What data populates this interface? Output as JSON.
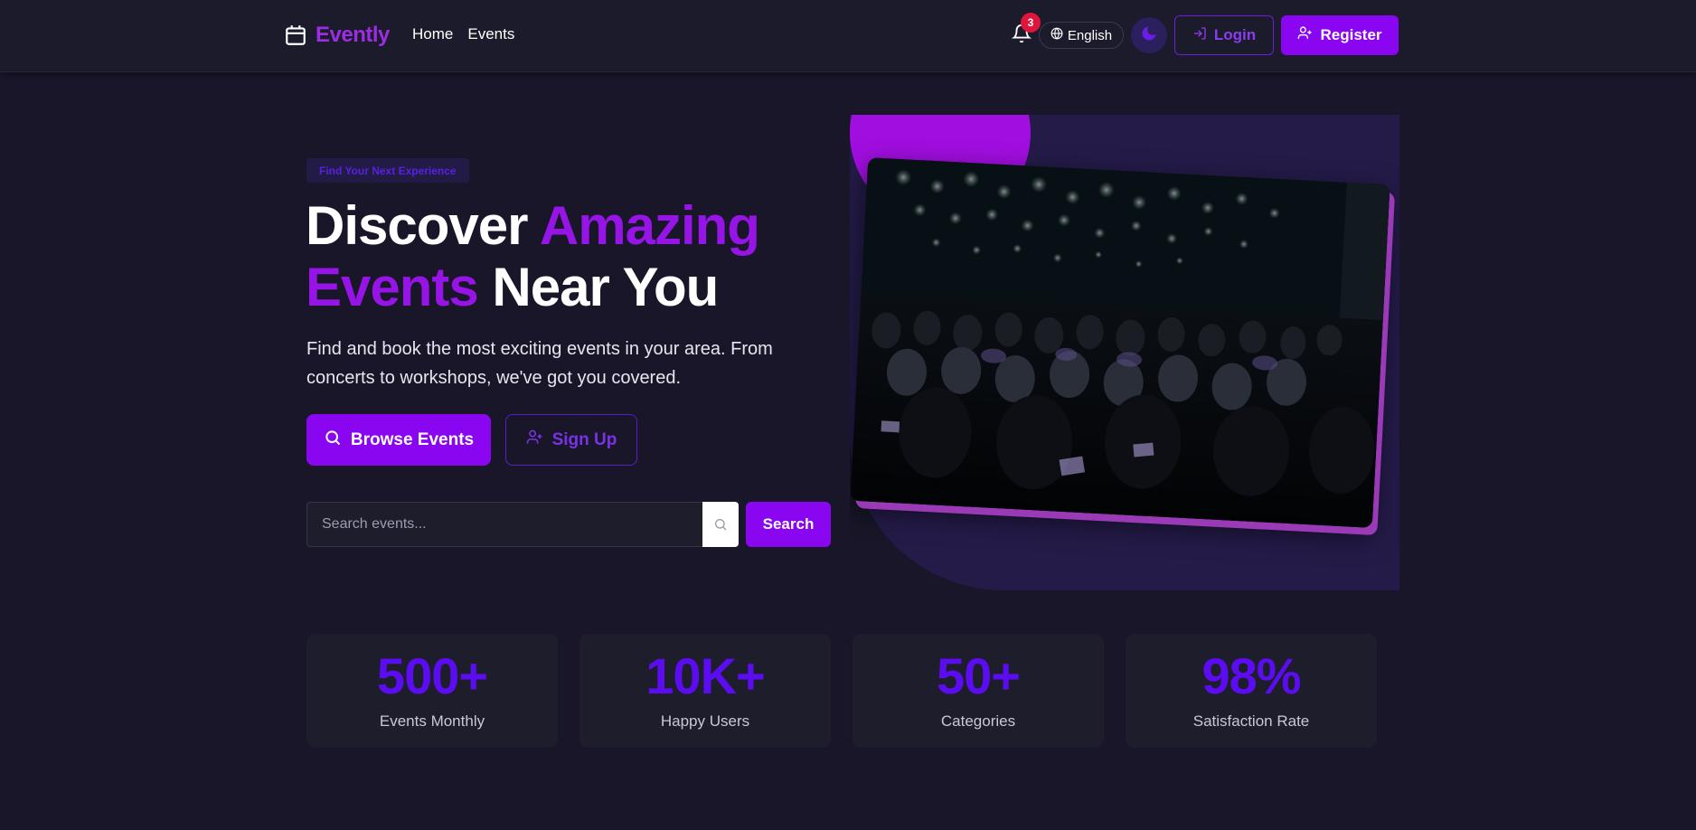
{
  "nav": {
    "brand": "Evently",
    "links": [
      "Home",
      "Events"
    ],
    "notification_count": "3",
    "language": "English",
    "login_label": "Login",
    "register_label": "Register"
  },
  "hero": {
    "tag": "Find Your Next Experience",
    "title_part1": "Discover ",
    "title_accent1": "Amazing",
    "title_accent2": "Events",
    "title_part2": " Near You",
    "description": "Find and book the most exciting events in your area. From concerts to workshops, we've got you covered.",
    "browse_label": "Browse Events",
    "signup_label": "Sign Up",
    "search_placeholder": "Search events...",
    "search_label": "Search"
  },
  "stats": [
    {
      "value": "500+",
      "label": "Events Monthly"
    },
    {
      "value": "10K+",
      "label": "Happy Users"
    },
    {
      "value": "50+",
      "label": "Categories"
    },
    {
      "value": "98%",
      "label": "Satisfaction Rate"
    }
  ],
  "colors": {
    "accent": "#8a05f0",
    "brand": "#9b2de2",
    "stat_number": "#5b0cf0",
    "background": "#181628"
  },
  "icons": [
    "calendar-icon",
    "bell-icon",
    "globe-icon",
    "moon-icon",
    "login-icon",
    "user-plus-icon",
    "search-icon"
  ]
}
